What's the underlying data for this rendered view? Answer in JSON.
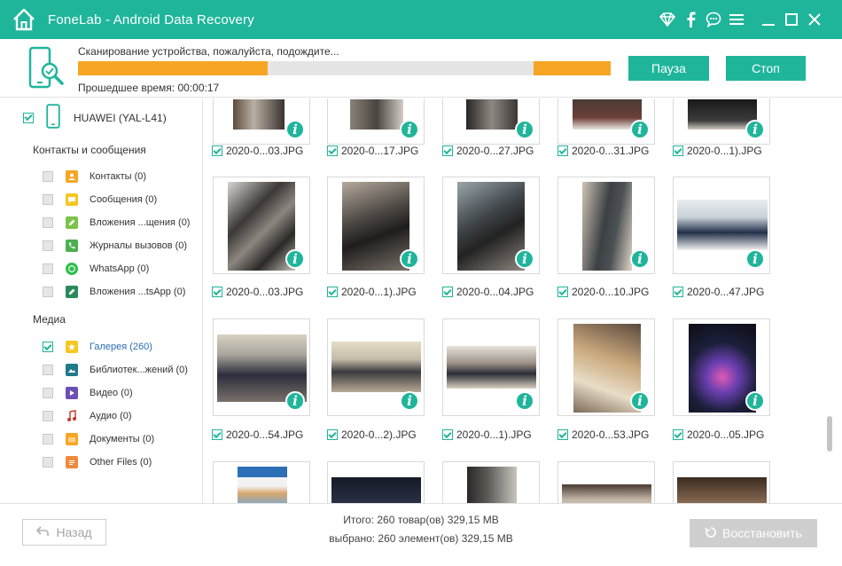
{
  "titlebar": {
    "title": "FoneLab - Android Data Recovery"
  },
  "scan": {
    "message": "Сканирование устройства, пожалуйста, подождите...",
    "elapsed": "Прошедшее время: 00:00:17",
    "pause_label": "Пауза",
    "stop_label": "Стоп"
  },
  "device": {
    "name": "HUAWEI (YAL-L41)"
  },
  "sidebar": {
    "section_contacts": "Контакты и сообщения",
    "section_media": "Медиа",
    "contacts_items": [
      {
        "label": "Контакты (0)",
        "icon": "contacts-icon",
        "color": "#f6a623"
      },
      {
        "label": "Сообщения (0)",
        "icon": "messages-icon",
        "color": "#f6c623"
      },
      {
        "label": "Вложения ...щения (0)",
        "icon": "attachment-icon",
        "color": "#7cc24b"
      },
      {
        "label": "Журналы вызовов (0)",
        "icon": "call-log-icon",
        "color": "#4caf50"
      },
      {
        "label": "WhatsApp (0)",
        "icon": "whatsapp-icon",
        "color": "#2fbe4a"
      },
      {
        "label": "Вложения ...tsApp (0)",
        "icon": "whatsapp-attachment-icon",
        "color": "#2a8a5a"
      }
    ],
    "media_items": [
      {
        "label": "Галерея (260)",
        "icon": "gallery-icon",
        "color": "#f6c623"
      },
      {
        "label": "Библиотек...жений (0)",
        "icon": "image-library-icon",
        "color": "#1f7a8c"
      },
      {
        "label": "Видео (0)",
        "icon": "video-icon",
        "color": "#6b4fb5"
      },
      {
        "label": "Аудио (0)",
        "icon": "audio-icon",
        "color": "#c0392b"
      },
      {
        "label": "Документы (0)",
        "icon": "documents-icon",
        "color": "#f6a623"
      },
      {
        "label": "Other Files (0)",
        "icon": "other-files-icon",
        "color": "#f08a3c"
      }
    ]
  },
  "grid": {
    "rows": [
      [
        "2020-0...03.JPG",
        "2020-0...17.JPG",
        "2020-0...27.JPG",
        "2020-0...31.JPG",
        "2020-0...1).JPG"
      ],
      [
        "2020-0...03.JPG",
        "2020-0...1).JPG",
        "2020-0...04.JPG",
        "2020-0...10.JPG",
        "2020-0...47.JPG"
      ],
      [
        "2020-0...54.JPG",
        "2020-0...2).JPG",
        "2020-0...1).JPG",
        "2020-0...53.JPG",
        "2020-0...05.JPG"
      ]
    ]
  },
  "footer": {
    "back_label": "Назад",
    "total": "Итого: 260 товар(ов) 329,15 MB",
    "selected": "выбрано: 260 элемент(ов) 329,15 MB",
    "recover_label": "Восстановить"
  },
  "colors": {
    "accent": "#1fb59b",
    "progress": "#f6a623"
  }
}
